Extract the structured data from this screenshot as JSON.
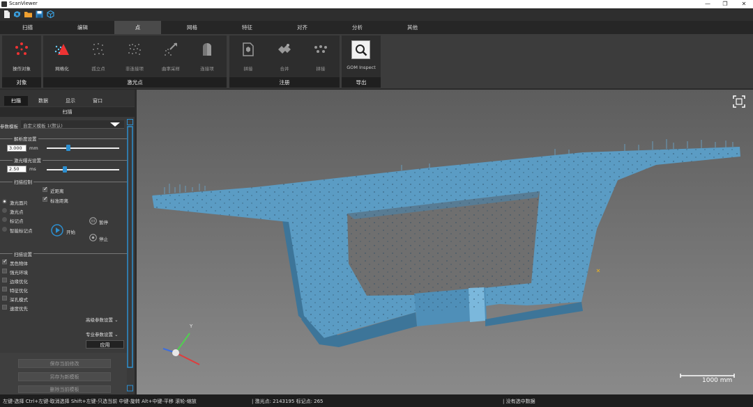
{
  "app": {
    "title": "ScanViewer"
  },
  "window_controls": {
    "minimize": "—",
    "maximize": "❐",
    "close": "✕"
  },
  "quick_access": [
    "new-file-icon",
    "sync-icon",
    "open-folder-icon",
    "save-icon",
    "cube-icon"
  ],
  "tabs": [
    "扫描",
    "编辑",
    "点",
    "网格",
    "特征",
    "对齐",
    "分析",
    "其他"
  ],
  "active_tab": "点",
  "ribbon": {
    "groups": [
      {
        "title": "对象",
        "buttons": [
          "操作对象"
        ]
      },
      {
        "title": "激光点",
        "buttons": [
          "网格化",
          "孤立点",
          "非连接项",
          "曲率采样",
          "连接项"
        ]
      },
      {
        "title": "注册",
        "buttons": [
          "拼接",
          "合并",
          "拼接"
        ]
      },
      {
        "title": "导出",
        "buttons": [
          "GOM Inspect"
        ]
      }
    ]
  },
  "left_panel": {
    "tabs": [
      "扫描",
      "数据",
      "显示",
      "窗口"
    ],
    "header": "扫描",
    "template_label": "参数模板",
    "template_value": "自定义模板 1(默认)",
    "resolution_title": "解析度设置",
    "resolution_value": "3.000",
    "resolution_unit": "mm",
    "resolution_level": 0.3,
    "exposure_title": "激光曝光设置",
    "exposure_value": "2.50",
    "exposure_unit": "ms",
    "exposure_level": 0.25,
    "scan_control_title": "扫描控制",
    "near_distance": "近距离",
    "standard_distance": "标准距离",
    "modes": [
      "激光面片",
      "激光点",
      "标记点",
      "智能标记点"
    ],
    "start_label": "开始",
    "pause_label": "暂停",
    "stop_label": "停止",
    "scan_settings_title": "扫描设置",
    "settings": [
      "黑色物体",
      "强光环境",
      "边缘优化",
      "特征优化",
      "深孔模式",
      "速度优先"
    ],
    "advanced": "高级参数设置",
    "professional": "专业参数设置",
    "apply": "应用",
    "save_changes": "保存当前修改",
    "save_as": "另存为新模板",
    "delete_template": "删除当前模板"
  },
  "viewport": {
    "scale_label": "1000 mm",
    "axis_label": "Y"
  },
  "status": {
    "hint": "左键-选择 Ctrl+左键-取消选择 Shift+左键-只选当前 中键-旋转 Alt+中键-平移 滚轮-缩放",
    "points": "| 激光点: 2143195 标记点: 265",
    "selection": "| 没有选中数据"
  }
}
